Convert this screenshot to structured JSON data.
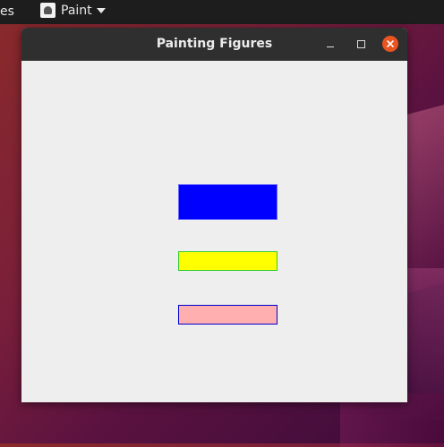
{
  "topbar": {
    "activities_label": "es",
    "app_menu_label": "Paint",
    "app_icon": "paint-app-icon",
    "caret_icon": "caret-down-icon"
  },
  "window": {
    "title": "Painting Figures",
    "controls": {
      "minimize_icon": "minimize-icon",
      "maximize_icon": "maximize-icon",
      "close_icon": "close-icon",
      "close_color": "#e95420"
    }
  },
  "figures": [
    {
      "shape": "rectangle",
      "fill": "#0000ff",
      "stroke": "#6a6aff"
    },
    {
      "shape": "rectangle",
      "fill": "#ffff00",
      "stroke": "#33cc33"
    },
    {
      "shape": "rectangle",
      "fill": "#ffafaf",
      "stroke": "#0000cc"
    }
  ]
}
